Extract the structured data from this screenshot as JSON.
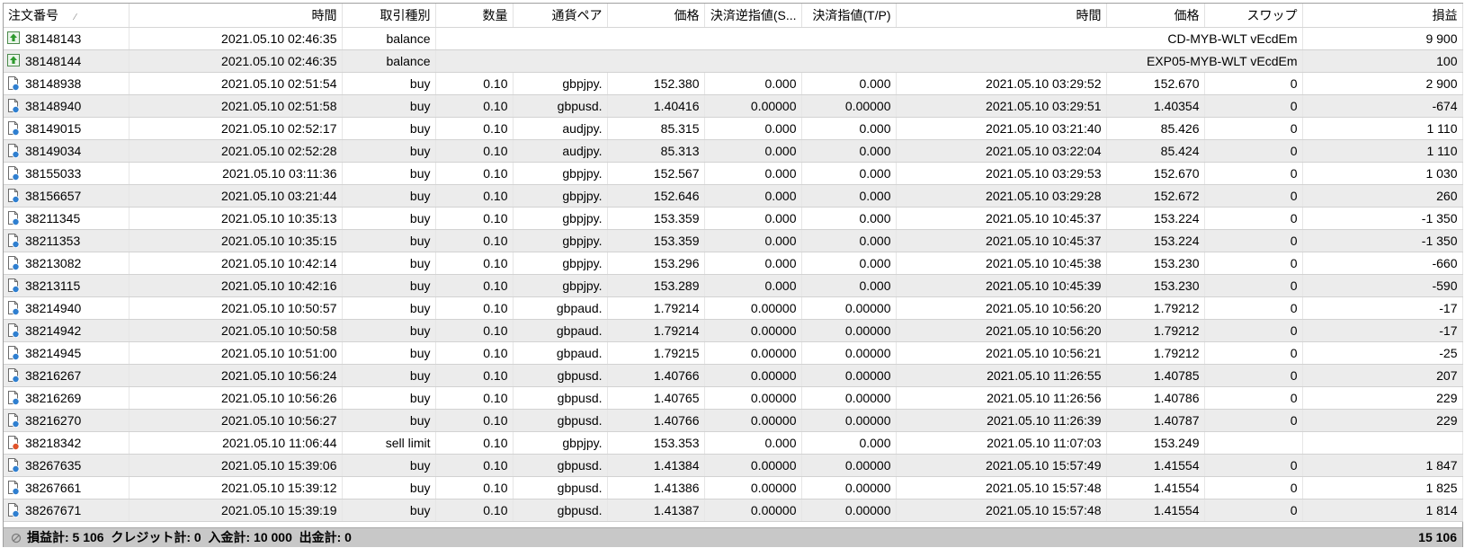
{
  "columns": [
    "注文番号",
    "時間",
    "取引種別",
    "数量",
    "通貨ペア",
    "価格",
    "決済逆指値(S...",
    "決済指値(T/P)",
    "時間",
    "価格",
    "スワップ",
    "損益"
  ],
  "sort_indicator": "⁄",
  "rows": [
    {
      "kind": "balance",
      "icon": "balance-icon",
      "id": "38148143",
      "time": "2021.05.10 02:46:35",
      "type": "balance",
      "comment": "CD-MYB-WLT vEcdEm",
      "profit": "9 900"
    },
    {
      "kind": "balance",
      "icon": "balance-icon",
      "id": "38148144",
      "time": "2021.05.10 02:46:35",
      "type": "balance",
      "comment": "EXP05-MYB-WLT vEcdEm",
      "profit": "100"
    },
    {
      "kind": "trade",
      "icon": "buy-order-icon",
      "id": "38148938",
      "time": "2021.05.10 02:51:54",
      "type": "buy",
      "volume": "0.10",
      "symbol": "gbpjpy.",
      "price": "152.380",
      "sl": "0.000",
      "tp": "0.000",
      "close_time": "2021.05.10 03:29:52",
      "close_price": "152.670",
      "swap": "0",
      "profit": "2 900"
    },
    {
      "kind": "trade",
      "icon": "buy-order-icon",
      "id": "38148940",
      "time": "2021.05.10 02:51:58",
      "type": "buy",
      "volume": "0.10",
      "symbol": "gbpusd.",
      "price": "1.40416",
      "sl": "0.00000",
      "tp": "0.00000",
      "close_time": "2021.05.10 03:29:51",
      "close_price": "1.40354",
      "swap": "0",
      "profit": "-674"
    },
    {
      "kind": "trade",
      "icon": "buy-order-icon",
      "id": "38149015",
      "time": "2021.05.10 02:52:17",
      "type": "buy",
      "volume": "0.10",
      "symbol": "audjpy.",
      "price": "85.315",
      "sl": "0.000",
      "tp": "0.000",
      "close_time": "2021.05.10 03:21:40",
      "close_price": "85.426",
      "swap": "0",
      "profit": "1 110"
    },
    {
      "kind": "trade",
      "icon": "buy-order-icon",
      "id": "38149034",
      "time": "2021.05.10 02:52:28",
      "type": "buy",
      "volume": "0.10",
      "symbol": "audjpy.",
      "price": "85.313",
      "sl": "0.000",
      "tp": "0.000",
      "close_time": "2021.05.10 03:22:04",
      "close_price": "85.424",
      "swap": "0",
      "profit": "1 110"
    },
    {
      "kind": "trade",
      "icon": "buy-order-icon",
      "id": "38155033",
      "time": "2021.05.10 03:11:36",
      "type": "buy",
      "volume": "0.10",
      "symbol": "gbpjpy.",
      "price": "152.567",
      "sl": "0.000",
      "tp": "0.000",
      "close_time": "2021.05.10 03:29:53",
      "close_price": "152.670",
      "swap": "0",
      "profit": "1 030"
    },
    {
      "kind": "trade",
      "icon": "buy-order-icon",
      "id": "38156657",
      "time": "2021.05.10 03:21:44",
      "type": "buy",
      "volume": "0.10",
      "symbol": "gbpjpy.",
      "price": "152.646",
      "sl": "0.000",
      "tp": "0.000",
      "close_time": "2021.05.10 03:29:28",
      "close_price": "152.672",
      "swap": "0",
      "profit": "260"
    },
    {
      "kind": "trade",
      "icon": "buy-order-icon",
      "id": "38211345",
      "time": "2021.05.10 10:35:13",
      "type": "buy",
      "volume": "0.10",
      "symbol": "gbpjpy.",
      "price": "153.359",
      "sl": "0.000",
      "tp": "0.000",
      "close_time": "2021.05.10 10:45:37",
      "close_price": "153.224",
      "swap": "0",
      "profit": "-1 350"
    },
    {
      "kind": "trade",
      "icon": "buy-order-icon",
      "id": "38211353",
      "time": "2021.05.10 10:35:15",
      "type": "buy",
      "volume": "0.10",
      "symbol": "gbpjpy.",
      "price": "153.359",
      "sl": "0.000",
      "tp": "0.000",
      "close_time": "2021.05.10 10:45:37",
      "close_price": "153.224",
      "swap": "0",
      "profit": "-1 350"
    },
    {
      "kind": "trade",
      "icon": "buy-order-icon",
      "id": "38213082",
      "time": "2021.05.10 10:42:14",
      "type": "buy",
      "volume": "0.10",
      "symbol": "gbpjpy.",
      "price": "153.296",
      "sl": "0.000",
      "tp": "0.000",
      "close_time": "2021.05.10 10:45:38",
      "close_price": "153.230",
      "swap": "0",
      "profit": "-660"
    },
    {
      "kind": "trade",
      "icon": "buy-order-icon",
      "id": "38213115",
      "time": "2021.05.10 10:42:16",
      "type": "buy",
      "volume": "0.10",
      "symbol": "gbpjpy.",
      "price": "153.289",
      "sl": "0.000",
      "tp": "0.000",
      "close_time": "2021.05.10 10:45:39",
      "close_price": "153.230",
      "swap": "0",
      "profit": "-590"
    },
    {
      "kind": "trade",
      "icon": "buy-order-icon",
      "id": "38214940",
      "time": "2021.05.10 10:50:57",
      "type": "buy",
      "volume": "0.10",
      "symbol": "gbpaud.",
      "price": "1.79214",
      "sl": "0.00000",
      "tp": "0.00000",
      "close_time": "2021.05.10 10:56:20",
      "close_price": "1.79212",
      "swap": "0",
      "profit": "-17"
    },
    {
      "kind": "trade",
      "icon": "buy-order-icon",
      "id": "38214942",
      "time": "2021.05.10 10:50:58",
      "type": "buy",
      "volume": "0.10",
      "symbol": "gbpaud.",
      "price": "1.79214",
      "sl": "0.00000",
      "tp": "0.00000",
      "close_time": "2021.05.10 10:56:20",
      "close_price": "1.79212",
      "swap": "0",
      "profit": "-17"
    },
    {
      "kind": "trade",
      "icon": "buy-order-icon",
      "id": "38214945",
      "time": "2021.05.10 10:51:00",
      "type": "buy",
      "volume": "0.10",
      "symbol": "gbpaud.",
      "price": "1.79215",
      "sl": "0.00000",
      "tp": "0.00000",
      "close_time": "2021.05.10 10:56:21",
      "close_price": "1.79212",
      "swap": "0",
      "profit": "-25"
    },
    {
      "kind": "trade",
      "icon": "buy-order-icon",
      "id": "38216267",
      "time": "2021.05.10 10:56:24",
      "type": "buy",
      "volume": "0.10",
      "symbol": "gbpusd.",
      "price": "1.40766",
      "sl": "0.00000",
      "tp": "0.00000",
      "close_time": "2021.05.10 11:26:55",
      "close_price": "1.40785",
      "swap": "0",
      "profit": "207"
    },
    {
      "kind": "trade",
      "icon": "buy-order-icon",
      "id": "38216269",
      "time": "2021.05.10 10:56:26",
      "type": "buy",
      "volume": "0.10",
      "symbol": "gbpusd.",
      "price": "1.40765",
      "sl": "0.00000",
      "tp": "0.00000",
      "close_time": "2021.05.10 11:26:56",
      "close_price": "1.40786",
      "swap": "0",
      "profit": "229"
    },
    {
      "kind": "trade",
      "icon": "buy-order-icon",
      "id": "38216270",
      "time": "2021.05.10 10:56:27",
      "type": "buy",
      "volume": "0.10",
      "symbol": "gbpusd.",
      "price": "1.40766",
      "sl": "0.00000",
      "tp": "0.00000",
      "close_time": "2021.05.10 11:26:39",
      "close_price": "1.40787",
      "swap": "0",
      "profit": "229"
    },
    {
      "kind": "trade",
      "icon": "sell-limit-order-icon",
      "id": "38218342",
      "time": "2021.05.10 11:06:44",
      "type": "sell limit",
      "volume": "0.10",
      "symbol": "gbpjpy.",
      "price": "153.353",
      "sl": "0.000",
      "tp": "0.000",
      "close_time": "2021.05.10 11:07:03",
      "close_price": "153.249",
      "swap": "",
      "profit": ""
    },
    {
      "kind": "trade",
      "icon": "buy-order-icon",
      "id": "38267635",
      "time": "2021.05.10 15:39:06",
      "type": "buy",
      "volume": "0.10",
      "symbol": "gbpusd.",
      "price": "1.41384",
      "sl": "0.00000",
      "tp": "0.00000",
      "close_time": "2021.05.10 15:57:49",
      "close_price": "1.41554",
      "swap": "0",
      "profit": "1 847"
    },
    {
      "kind": "trade",
      "icon": "buy-order-icon",
      "id": "38267661",
      "time": "2021.05.10 15:39:12",
      "type": "buy",
      "volume": "0.10",
      "symbol": "gbpusd.",
      "price": "1.41386",
      "sl": "0.00000",
      "tp": "0.00000",
      "close_time": "2021.05.10 15:57:48",
      "close_price": "1.41554",
      "swap": "0",
      "profit": "1 825"
    },
    {
      "kind": "trade",
      "icon": "buy-order-icon",
      "id": "38267671",
      "time": "2021.05.10 15:39:19",
      "type": "buy",
      "volume": "0.10",
      "symbol": "gbpusd.",
      "price": "1.41387",
      "sl": "0.00000",
      "tp": "0.00000",
      "close_time": "2021.05.10 15:57:48",
      "close_price": "1.41554",
      "swap": "0",
      "profit": "1 814"
    }
  ],
  "footer": {
    "summary": "損益計: 5 106  クレジット計: 0  入金計: 10 000  出金計: 0",
    "total": "15 106",
    "icon": "stop-icon"
  },
  "colors": {
    "balance_icon": "#2e9a2e",
    "buy_icon": "#2f7fd0",
    "sell_icon": "#e0532a",
    "stripe": "#ececec",
    "footer_bg": "#c8c8c8"
  }
}
